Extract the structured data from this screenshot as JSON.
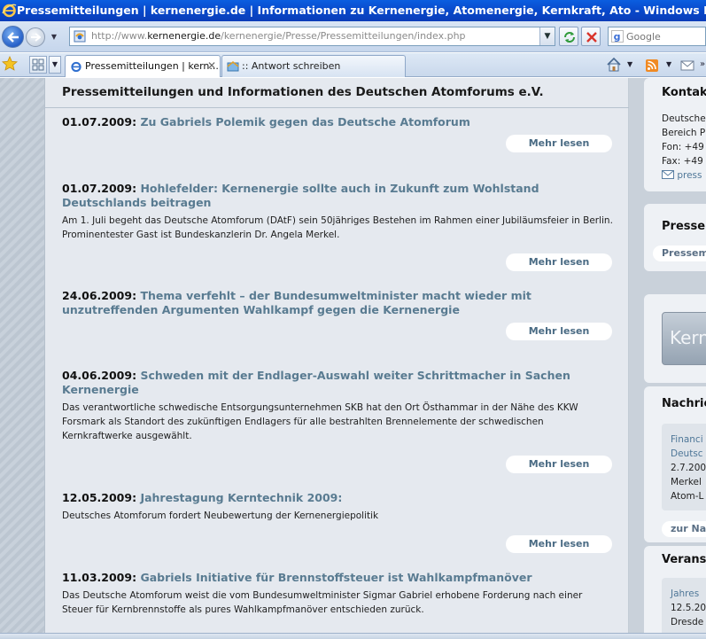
{
  "window": {
    "title": "Pressemitteilungen | kernenergie.de | Informationen zu Kernenergie, Atomenergie, Kernkraft, Ato - Windows Internet Explorer"
  },
  "address_bar": {
    "url_prefix": "http://www.",
    "url_host": "kernenergie.de",
    "url_path": "/kernenergie/Presse/Pressemitteilungen/index.php",
    "search_placeholder": "Google"
  },
  "tabs": [
    {
      "label": "Pressemitteilungen | kern...",
      "active": true
    },
    {
      "label": ":: Antwort schreiben",
      "active": false
    }
  ],
  "main": {
    "title": "Pressemitteilungen und Informationen des Deutschen Atomforums e.V.",
    "more_label": "Mehr lesen",
    "items": [
      {
        "date": "01.07.2009:",
        "headline": "Zu Gabriels Polemik gegen das Deutsche Atomforum",
        "body": ""
      },
      {
        "date": "01.07.2009:",
        "headline": "Hohlefelder: Kernenergie sollte auch in Zukunft zum Wohlstand Deutschlands beitragen",
        "body": "Am 1. Juli begeht das Deutsche Atomforum (DAtF) sein 50jähriges Bestehen im Rahmen einer Jubiläumsfeier in Berlin. Prominentester Gast ist Bundeskanzlerin Dr. Angela Merkel."
      },
      {
        "date": "24.06.2009:",
        "headline": "Thema verfehlt – der Bundesumweltminister macht wieder mit unzutreffenden Argumenten Wahlkampf gegen die Kernenergie",
        "body": ""
      },
      {
        "date": "04.06.2009:",
        "headline": "Schweden mit der Endlager-Auswahl weiter Schrittmacher in Sachen Kernenergie",
        "body": "Das verantwortliche schwedische Entsorgungsunternehmen SKB hat den Ort Östhammar in der Nähe des KKW Forsmark als Standort des zukünftigen Endlagers für alle bestrahlten Brennelemente der schwedischen Kernkraftwerke ausgewählt."
      },
      {
        "date": "12.05.2009:",
        "headline": "Jahrestagung Kerntechnik 2009:",
        "body": "Deutsches Atomforum fordert Neubewertung der Kernenergiepolitik"
      },
      {
        "date": "11.03.2009:",
        "headline": "Gabriels Initiative für Brennstoffsteuer ist Wahlkampfmanöver",
        "body": "Das Deutsche Atomforum weist die vom Bundesumweltminister Sigmar Gabriel erhobene Forderung nach einer Steuer für Kernbrennstoffe als pures Wahlkampfmanöver entschieden zurück."
      }
    ]
  },
  "sidebar": {
    "kontakt_heading": "Kontakt",
    "kontakt_lines": [
      "Deutsche",
      "Bereich P",
      "Fon: +49",
      "Fax: +49"
    ],
    "kontakt_email": "press",
    "presse_heading": "Presse",
    "presse_pill": "Pressem",
    "banner_text": "Kerne",
    "nachrichten_heading": "Nachrich",
    "news_source": "Financi",
    "news_source2": "Deutsc",
    "news_lines": [
      "2.7.200",
      "Merkel",
      "Atom-L"
    ],
    "zur_pill": "zur Na",
    "veranst_heading": "Veranst",
    "veranst_link": "Jahres",
    "veranst_lines": [
      "12.5.20",
      "Dresde"
    ]
  }
}
